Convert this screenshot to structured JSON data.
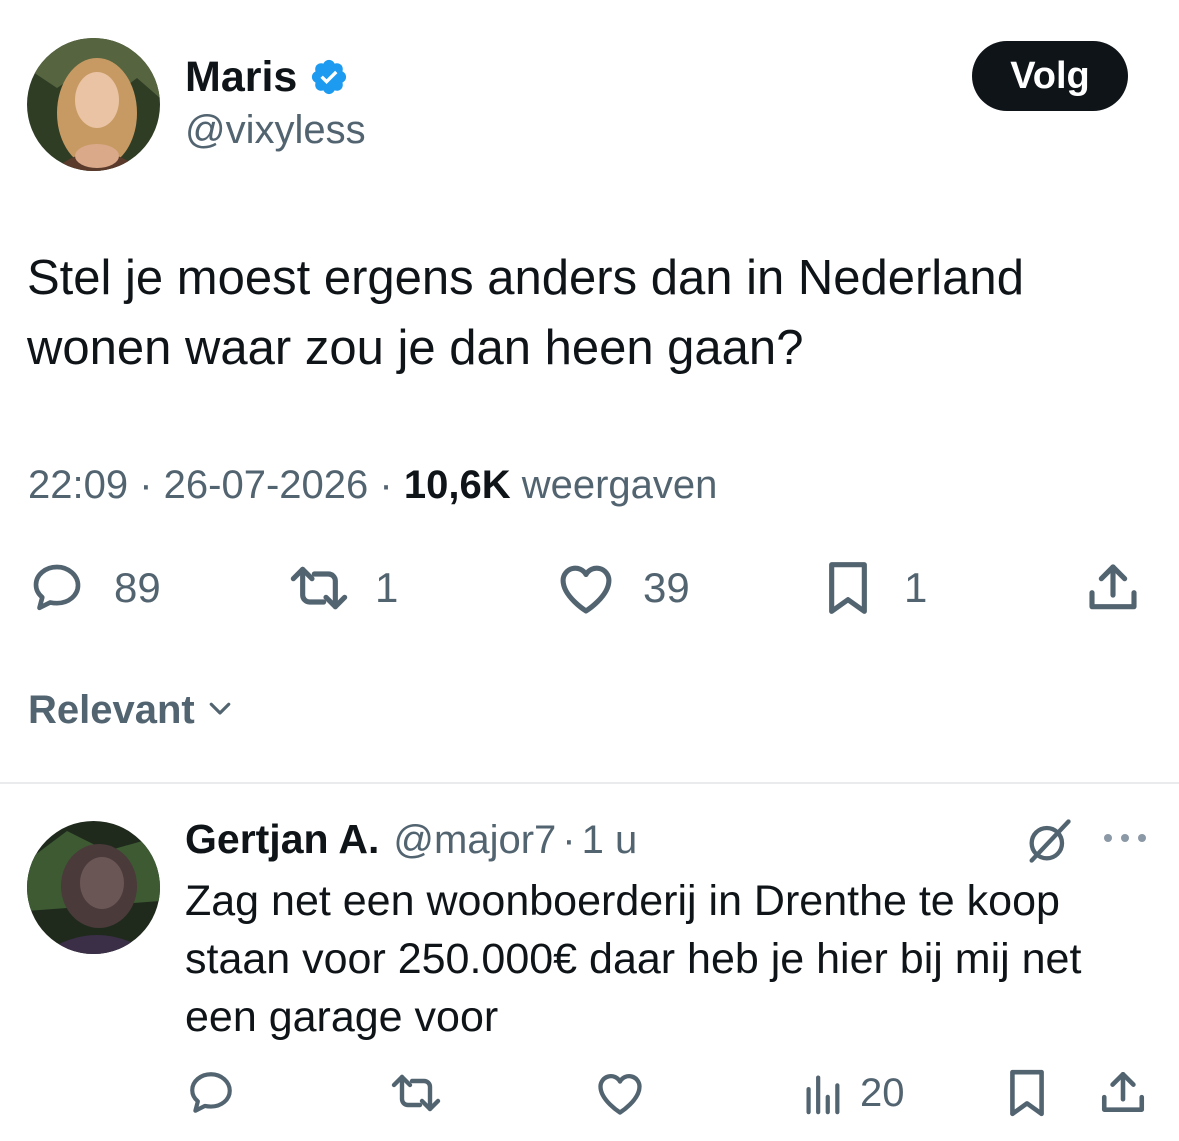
{
  "tweet": {
    "author_name": "Maris",
    "author_handle": "@vixyless",
    "follow_label": "Volg",
    "text_line1": "Stel je moest ergens anders dan in Nederland",
    "text_line2": "wonen waar zou je dan heen gaan?",
    "time": "22:09",
    "date": "26-07-2026",
    "views_count": "10,6K",
    "views_label": "weergaven",
    "replies": "89",
    "retweets": "1",
    "likes": "39",
    "bookmarks": "1"
  },
  "sort": {
    "label": "Relevant"
  },
  "reply": {
    "author_name": "Gertjan A.",
    "author_handle": "@major7",
    "separator": "·",
    "age": "1 u",
    "text_line1": "Zag net een woonboerderij in Drenthe te koop",
    "text_line2": "staan voor 250.000€ daar heb je hier bij mij net",
    "text_line3": "een garage voor",
    "views": "20"
  },
  "icons": {
    "verified": "verified-badge-icon",
    "reply": "comment-icon",
    "retweet": "retweet-icon",
    "like": "heart-icon",
    "bookmark": "bookmark-icon",
    "share": "share-icon",
    "views": "analytics-icon",
    "chevron": "chevron-down-icon",
    "grok": "grok-icon",
    "more": "more-icon"
  },
  "colors": {
    "verified_blue": "#1d9bf0",
    "text": "#0f1419",
    "secondary": "#536471"
  }
}
